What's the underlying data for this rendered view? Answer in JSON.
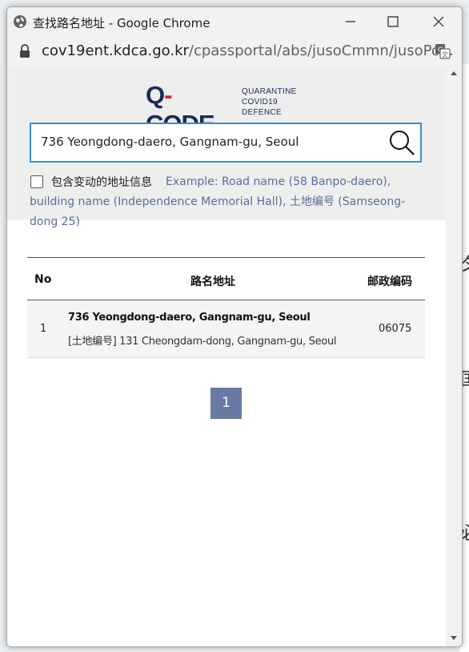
{
  "window": {
    "title": "查找路名地址 - Google Chrome",
    "url_host": "cov19ent.kdca.go.kr",
    "url_path": "/cpassportal/abs/jusoCmmn/jusoPo..."
  },
  "logo": {
    "main": "Q-CODE",
    "sub_line1": "QUARANTINE",
    "sub_line2": "COVID19 DEFENCE"
  },
  "search": {
    "value": "736 Yeongdong-daero, Gangnam-gu, Seoul",
    "checkbox_label": "包含变动的地址信息",
    "example": "Example: Road name (58 Banpo-daero), building name (Independence Memorial Hall), 土地编号 (Samseong-dong 25)"
  },
  "table": {
    "headers": {
      "no": "No",
      "address": "路名地址",
      "zip": "邮政编码"
    },
    "rows": [
      {
        "no": "1",
        "road": "736 Yeongdong-daero, Gangnam-gu, Seoul",
        "jibun": "[土地编号] 131 Cheongdam-dong, Gangnam-gu, Seoul",
        "zip": "06075"
      }
    ]
  },
  "pagination": {
    "current": "1"
  },
  "colors": {
    "accent_border": "#3a8fc9",
    "logo_navy": "#1a2a5c",
    "logo_red": "#d2232a",
    "example_text": "#5a6f9a",
    "page_button": "#6b7aa5"
  },
  "icons": [
    "globe-icon",
    "minimize-icon",
    "maximize-icon",
    "close-icon",
    "lock-icon",
    "translate-icon",
    "search-icon",
    "scroll-up-icon",
    "scroll-down-icon"
  ]
}
